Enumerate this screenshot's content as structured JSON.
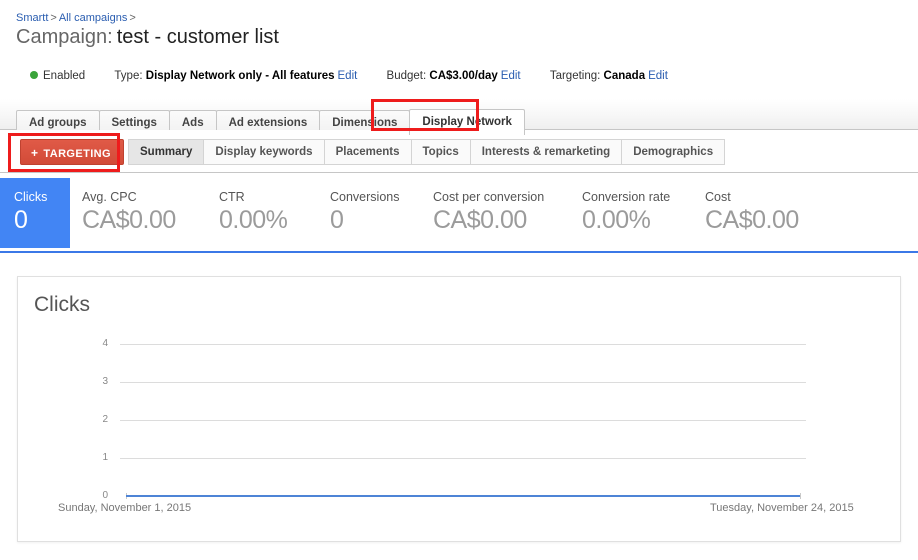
{
  "breadcrumb": {
    "account": "Smartt",
    "sep1": ">",
    "all_campaigns": "All campaigns",
    "sep2": ">"
  },
  "header": {
    "campaign_label": "Campaign:",
    "campaign_name": "test - customer list"
  },
  "status": {
    "state": "Enabled",
    "state_color": "#3aa43a",
    "type_label": "Type:",
    "type_value": "Display Network only - All features",
    "type_edit": "Edit",
    "budget_label": "Budget:",
    "budget_value": "CA$3.00/day",
    "budget_edit": "Edit",
    "targeting_label": "Targeting:",
    "targeting_value": "Canada",
    "targeting_edit": "Edit"
  },
  "tabs": [
    {
      "label": "Ad groups",
      "active": false
    },
    {
      "label": "Settings",
      "active": false
    },
    {
      "label": "Ads",
      "active": false
    },
    {
      "label": "Ad extensions",
      "active": false
    },
    {
      "label": "Dimensions",
      "active": false
    },
    {
      "label": "Display Network",
      "active": true
    }
  ],
  "targeting_button": {
    "plus": "+",
    "label": "TARGETING",
    "color": "#d24b38"
  },
  "subtabs": [
    {
      "label": "Summary",
      "active": true
    },
    {
      "label": "Display keywords",
      "active": false
    },
    {
      "label": "Placements",
      "active": false
    },
    {
      "label": "Topics",
      "active": false
    },
    {
      "label": "Interests & remarketing",
      "active": false
    },
    {
      "label": "Demographics",
      "active": false
    }
  ],
  "metrics": [
    {
      "label": "Clicks",
      "value": "0",
      "selected": true
    },
    {
      "label": "Avg. CPC",
      "value": "CA$0.00",
      "selected": false
    },
    {
      "label": "CTR",
      "value": "0.00%",
      "selected": false
    },
    {
      "label": "Conversions",
      "value": "0",
      "selected": false
    },
    {
      "label": "Cost per conversion",
      "value": "CA$0.00",
      "selected": false
    },
    {
      "label": "Conversion rate",
      "value": "0.00%",
      "selected": false
    },
    {
      "label": "Cost",
      "value": "CA$0.00",
      "selected": false
    }
  ],
  "highlights": {
    "color": "#ee1c1c",
    "boxes": [
      "display-network-tab",
      "targeting-button"
    ]
  },
  "chart_data": {
    "type": "line",
    "title": "Clicks",
    "xlabel": "",
    "ylabel": "",
    "ylim": [
      0,
      4
    ],
    "yticks": [
      0,
      1,
      2,
      3,
      4
    ],
    "grid": true,
    "legend": "none",
    "line_color": "#4e84d6",
    "x_start_label": "Sunday, November 1, 2015",
    "x_end_label": "Tuesday, November 24, 2015",
    "x": [
      "2015-11-01",
      "2015-11-02",
      "2015-11-03",
      "2015-11-04",
      "2015-11-05",
      "2015-11-06",
      "2015-11-07",
      "2015-11-08",
      "2015-11-09",
      "2015-11-10",
      "2015-11-11",
      "2015-11-12",
      "2015-11-13",
      "2015-11-14",
      "2015-11-15",
      "2015-11-16",
      "2015-11-17",
      "2015-11-18",
      "2015-11-19",
      "2015-11-20",
      "2015-11-21",
      "2015-11-22",
      "2015-11-23",
      "2015-11-24"
    ],
    "series": [
      {
        "name": "Clicks",
        "values": [
          0,
          0,
          0,
          0,
          0,
          0,
          0,
          0,
          0,
          0,
          0,
          0,
          0,
          0,
          0,
          0,
          0,
          0,
          0,
          0,
          0,
          0,
          0,
          0
        ]
      }
    ]
  }
}
